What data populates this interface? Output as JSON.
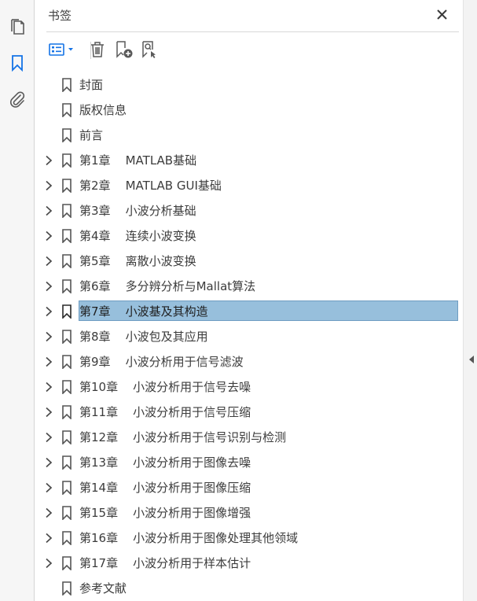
{
  "panel": {
    "title": "书签"
  },
  "bookmarks": [
    {
      "label": "封面",
      "expandable": false
    },
    {
      "label": "版权信息",
      "expandable": false
    },
    {
      "label": "前言",
      "expandable": false
    },
    {
      "label": "第1章    MATLAB基础",
      "expandable": true
    },
    {
      "label": "第2章    MATLAB GUI基础",
      "expandable": true
    },
    {
      "label": "第3章    小波分析基础",
      "expandable": true
    },
    {
      "label": "第4章    连续小波变换",
      "expandable": true
    },
    {
      "label": "第5章    离散小波变换",
      "expandable": true
    },
    {
      "label": "第6章    多分辨分析与Mallat算法",
      "expandable": true
    },
    {
      "label": "第7章    小波基及其构造",
      "expandable": true,
      "selected": true
    },
    {
      "label": "第8章    小波包及其应用",
      "expandable": true
    },
    {
      "label": "第9章    小波分析用于信号滤波",
      "expandable": true
    },
    {
      "label": "第10章    小波分析用于信号去噪",
      "expandable": true
    },
    {
      "label": "第11章    小波分析用于信号压缩",
      "expandable": true
    },
    {
      "label": "第12章    小波分析用于信号识别与检测",
      "expandable": true
    },
    {
      "label": "第13章    小波分析用于图像去噪",
      "expandable": true
    },
    {
      "label": "第14章    小波分析用于图像压缩",
      "expandable": true
    },
    {
      "label": "第15章    小波分析用于图像增强",
      "expandable": true
    },
    {
      "label": "第16章    小波分析用于图像处理其他领域",
      "expandable": true
    },
    {
      "label": "第17章    小波分析用于样本估计",
      "expandable": true
    },
    {
      "label": "参考文献",
      "expandable": false
    }
  ],
  "icons": {
    "rail": [
      "pages-icon",
      "bookmark-icon",
      "attachment-icon"
    ],
    "toolbar": [
      "options-menu-icon",
      "delete-bookmark-icon",
      "new-bookmark-icon",
      "bookmark-search-icon"
    ],
    "close": "close-icon"
  },
  "colors": {
    "selection": "#97bfdc",
    "selection_border": "#6f9dc2",
    "accent": "#1473e6"
  }
}
